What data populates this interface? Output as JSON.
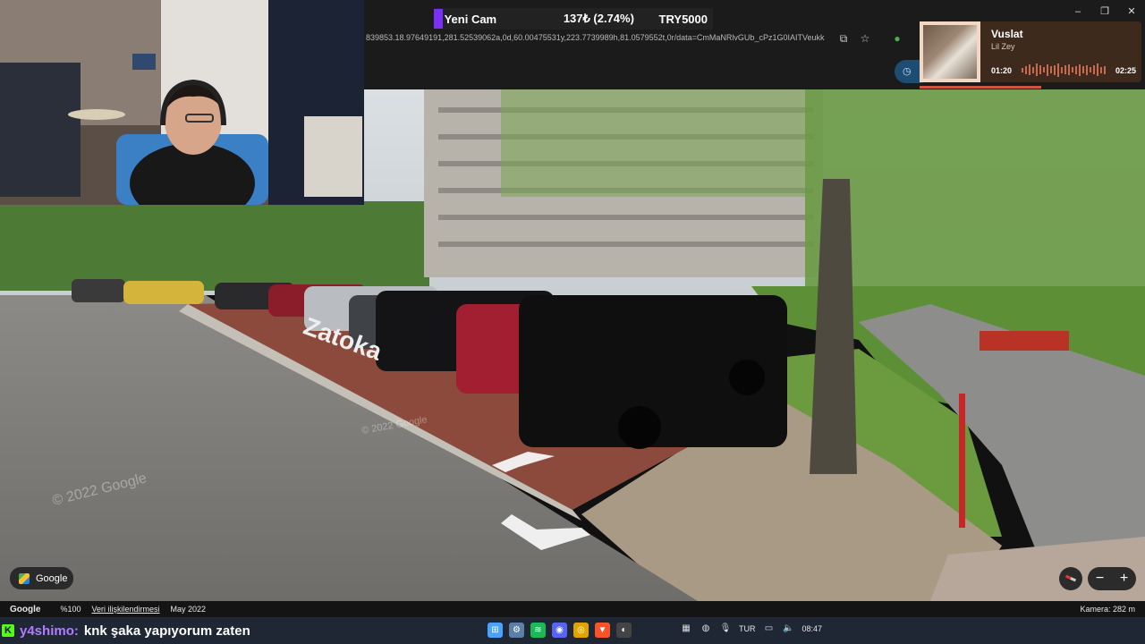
{
  "ticker": {
    "name": "Yeni Cam",
    "change": "137₺ (2.74%)",
    "target": "TRY5000"
  },
  "browser": {
    "url": "839853.18.97649191,281.52539062a,0d,60.00475531y,223.7739989h,81.0579552t,0r/data=CmMaNRlvGUb_cPz1G0IAITVeukk",
    "window_controls": [
      "–",
      "❐",
      "✕"
    ]
  },
  "music": {
    "title": "Vuslat",
    "artist": "Lil Zey",
    "elapsed": "01:20",
    "total": "02:25",
    "progress": 0.55
  },
  "map": {
    "google_chip": "Google",
    "watermark": "© 2022 Google",
    "watermark2": "© 2022 Google",
    "road_text": "Zatoka",
    "footer": {
      "logo": "Google",
      "zoom": "%100",
      "data_link": "Veri ilişkilendirmesi",
      "date": "May 2022",
      "camera": "Kamera: 282 m"
    },
    "zoom_controls": {
      "minus": "−",
      "plus": "+"
    }
  },
  "chat": {
    "platform": "K",
    "user": "y4shimo:",
    "message": "knk şaka yapıyorum zaten"
  },
  "taskbar": {
    "apps": [
      {
        "name": "start",
        "color": "#4aa3ff",
        "glyph": "⊞"
      },
      {
        "name": "network",
        "color": "#5b7fa8",
        "glyph": "⚙"
      },
      {
        "name": "spotify",
        "color": "#1db954",
        "glyph": "≋"
      },
      {
        "name": "discord",
        "color": "#5865f2",
        "glyph": "◉"
      },
      {
        "name": "chrome",
        "color": "#e0a400",
        "glyph": "◎"
      },
      {
        "name": "brave",
        "color": "#fb542b",
        "glyph": "▼"
      },
      {
        "name": "github",
        "color": "#444444",
        "glyph": "◐"
      }
    ],
    "lang": "TUR",
    "time": "08:47"
  }
}
